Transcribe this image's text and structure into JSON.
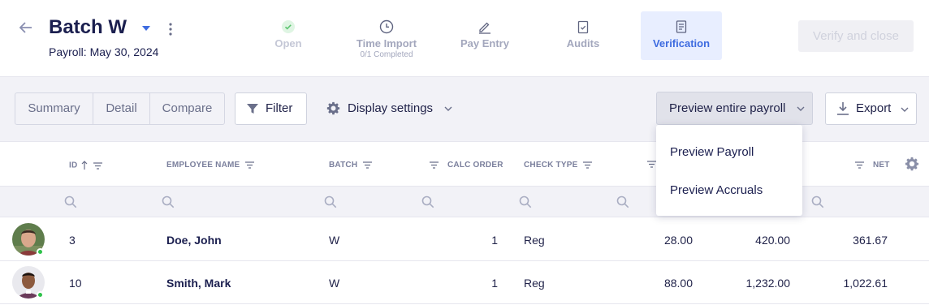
{
  "header": {
    "title": "Batch W",
    "subtitle": "Payroll: May 30, 2024",
    "steps": [
      {
        "label": "Open",
        "sub": ""
      },
      {
        "label": "Time Import",
        "sub": "0/1 Completed"
      },
      {
        "label": "Pay Entry",
        "sub": ""
      },
      {
        "label": "Audits",
        "sub": ""
      },
      {
        "label": "Verification",
        "sub": ""
      }
    ],
    "verify_button": "Verify and close"
  },
  "toolbar": {
    "view_tabs": [
      "Summary",
      "Detail",
      "Compare"
    ],
    "filter": "Filter",
    "display_settings": "Display settings",
    "preview": "Preview entire payroll",
    "export": "Export"
  },
  "dropdown": {
    "items": [
      "Preview Payroll",
      "Preview Accruals"
    ]
  },
  "columns": {
    "id": "ID",
    "employee_name": "EMPLOYEE NAME",
    "batch": "BATCH",
    "calc_order": "CALC ORDER",
    "check_type": "CHECK TYPE",
    "net": "NET"
  },
  "rows": [
    {
      "id": "3",
      "name": "Doe, John",
      "batch": "W",
      "calc_order": "1",
      "check_type": "Reg",
      "v1": "28.00",
      "v2": "420.00",
      "net": "361.67"
    },
    {
      "id": "10",
      "name": "Smith, Mark",
      "batch": "W",
      "calc_order": "1",
      "check_type": "Reg",
      "v1": "88.00",
      "v2": "1,232.00",
      "net": "1,022.61"
    }
  ],
  "colors": {
    "accent": "#3d6be0",
    "active_step_bg": "#e8eeff",
    "status_online": "#2ec24a"
  }
}
